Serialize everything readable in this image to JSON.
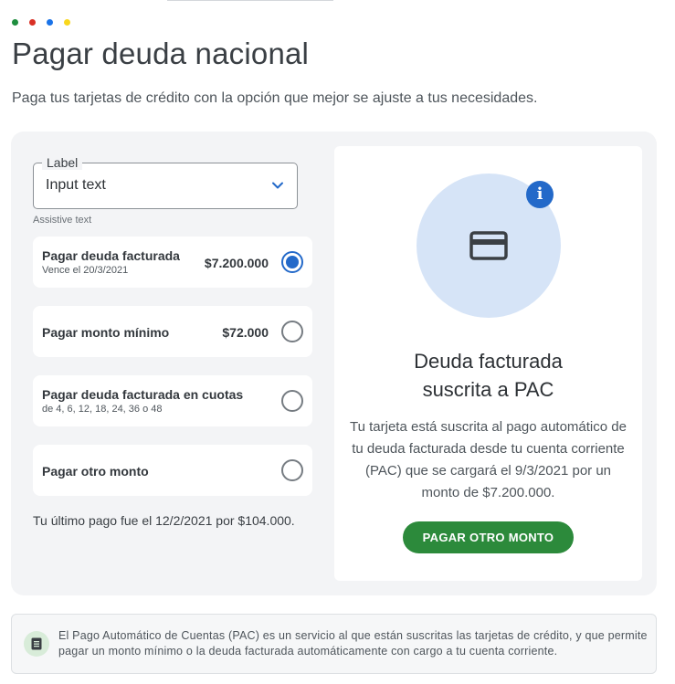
{
  "colors": {
    "dot_green": "#1e8e3e",
    "dot_red": "#d93025",
    "dot_blue": "#1a73e8",
    "dot_yellow": "#f9d71c",
    "accent_blue": "#2369c9",
    "cta_green": "#2c8a3b"
  },
  "header": {
    "title": "Pagar deuda nacional",
    "subtitle": "Paga tus tarjetas de crédito con la opción que mejor se ajuste a tus necesidades."
  },
  "select": {
    "label": "Label",
    "value": "Input text",
    "assistive": "Assistive text",
    "icon": "chevron-down-icon"
  },
  "options": [
    {
      "title": "Pagar deuda facturada",
      "subtitle": "Vence el 20/3/2021",
      "amount": "$7.200.000",
      "selected": true
    },
    {
      "title": "Pagar monto mínimo",
      "subtitle": "",
      "amount": "$72.000",
      "selected": false
    },
    {
      "title": "Pagar deuda facturada en cuotas",
      "subtitle": "de 4, 6, 12, 18, 24, 36 o 48",
      "amount": "",
      "selected": false
    },
    {
      "title": "Pagar otro monto",
      "subtitle": "",
      "amount": "",
      "selected": false
    }
  ],
  "last_payment": "Tu último pago fue el 12/2/2021 por $104.000.",
  "panel": {
    "title_line1": "Deuda facturada",
    "title_line2": "suscrita a PAC",
    "description": "Tu tarjeta está suscrita al pago automático de tu deuda facturada desde tu cuenta corriente (PAC) que se cargará el 9/3/2021 por un monto de $7.200.000.",
    "cta": "PAGAR OTRO MONTO",
    "icons": [
      "credit-card-icon",
      "info-icon"
    ]
  },
  "note": {
    "text": "El Pago Automático de Cuentas (PAC) es un servicio al que están suscritas las tarjetas de crédito, y que permite pagar un monto mínimo o la deuda facturada automáticamente con cargo a tu cuenta corriente.",
    "icon": "document-icon"
  }
}
